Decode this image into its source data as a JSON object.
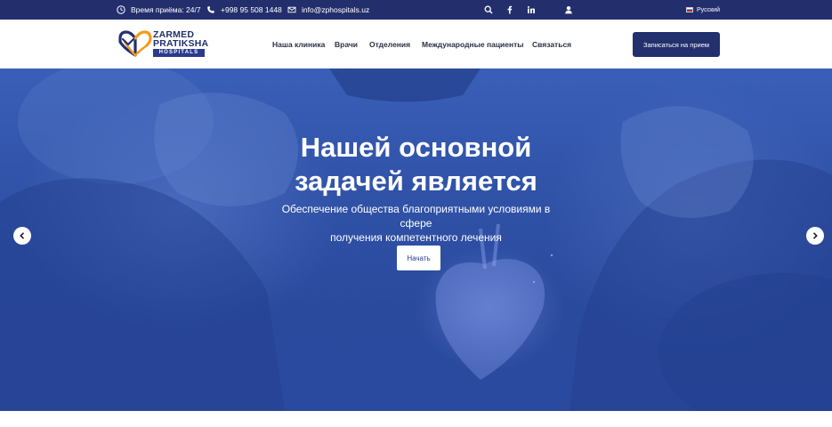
{
  "topbar": {
    "hours": "Время приёма: 24/7",
    "phone": "+998 95 508 1448",
    "email": "info@zphospitals.uz",
    "language": "Русский"
  },
  "logo": {
    "line1": "ZARMED",
    "line2": "PRATIKSHA",
    "line3": "HOSPITALS"
  },
  "nav": {
    "items": [
      {
        "label": "Наша клиника"
      },
      {
        "label": "Врачи"
      },
      {
        "label": "Отделения"
      },
      {
        "label": "Международные пациенты"
      },
      {
        "label": "Связаться"
      }
    ],
    "cta_label": "Записаться на прием"
  },
  "hero": {
    "title_line1": "Нашей основной",
    "title_line2": "задачей является",
    "subtitle_line1": "Обеспечение общества благоприятными условиями в сфере",
    "subtitle_line2": "получения компетентного лечения",
    "button_label": "Начать"
  },
  "icons": {
    "clock": "clock-icon",
    "phone": "phone-icon",
    "email": "envelope-icon",
    "search": "search-icon",
    "facebook": "facebook-icon",
    "linkedin": "linkedin-icon",
    "user": "user-icon",
    "prev": "chevron-left-icon",
    "next": "chevron-right-icon"
  },
  "colors": {
    "brand_navy": "#23306e",
    "hero_blue": "#2f51a6",
    "logo_orange": "#f39a1e"
  }
}
